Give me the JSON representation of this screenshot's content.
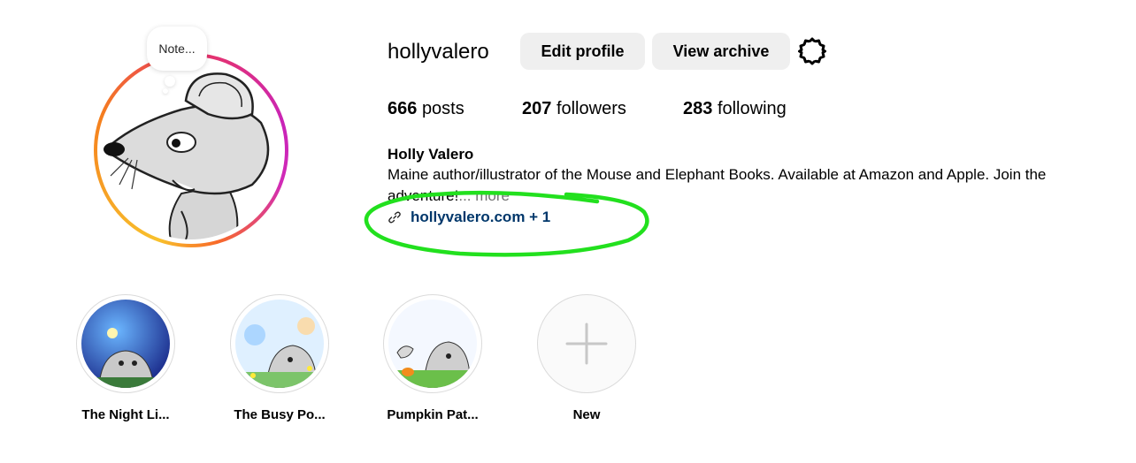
{
  "profile": {
    "username": "hollyvalero",
    "note": "Note...",
    "edit_label": "Edit profile",
    "archive_label": "View archive",
    "posts_count": "666",
    "posts_label": "posts",
    "followers_count": "207",
    "followers_label": "followers",
    "following_count": "283",
    "following_label": "following",
    "full_name": "Holly Valero",
    "bio": "Maine author/illustrator of the Mouse and Elephant Books. Available at Amazon and Apple. Join the adventure!",
    "more": "... more",
    "link": "hollyvalero.com + 1"
  },
  "highlights": [
    {
      "label": "The Night Li...",
      "cover_title": "The Night Lights",
      "icon": "night-lights-cover"
    },
    {
      "label": "The Busy Po...",
      "cover_title": "The Busy Pond",
      "icon": "busy-pond-cover"
    },
    {
      "label": "Pumpkin Pat...",
      "cover_title": "The Pumpkin Patch",
      "icon": "pumpkin-patch-cover"
    },
    {
      "label": "New",
      "icon": "plus-icon"
    }
  ],
  "colors": {
    "annotation": "#22e01e",
    "link": "#00376b",
    "button_bg": "#efefef"
  },
  "icons": {
    "settings": "gear-icon",
    "link": "link-icon"
  }
}
